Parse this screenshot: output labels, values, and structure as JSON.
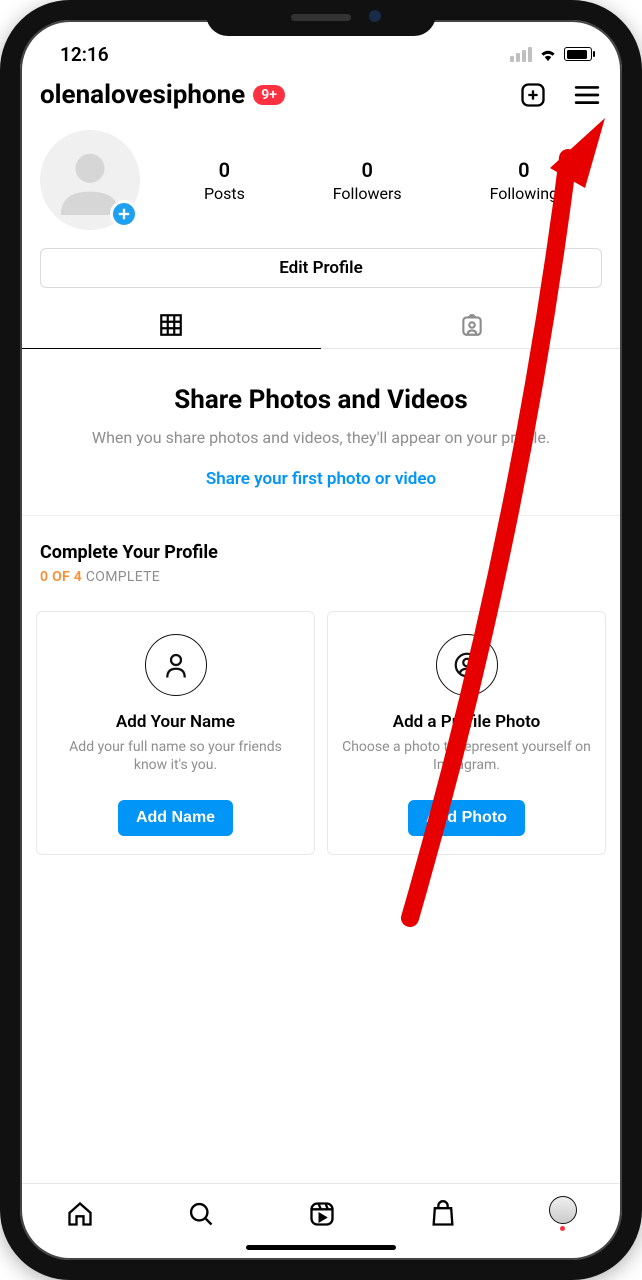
{
  "status": {
    "time": "12:16"
  },
  "header": {
    "username": "olenalovesiphone",
    "badge": "9+"
  },
  "profile": {
    "stats": [
      {
        "count": "0",
        "label": "Posts"
      },
      {
        "count": "0",
        "label": "Followers"
      },
      {
        "count": "0",
        "label": "Following"
      }
    ],
    "edit_label": "Edit Profile"
  },
  "empty_state": {
    "title": "Share Photos and Videos",
    "body": "When you share photos and videos, they'll appear on your profile.",
    "link": "Share your first photo or video"
  },
  "complete": {
    "title": "Complete Your Profile",
    "progress_done": "0 OF 4",
    "progress_rest": " COMPLETE",
    "cards": [
      {
        "title": "Add Your Name",
        "desc": "Add your full name so your friends know it's you.",
        "button": "Add Name"
      },
      {
        "title": "Add a Profile Photo",
        "desc": "Choose a photo to represent yourself on Instagram.",
        "button": "Add Photo"
      }
    ]
  }
}
